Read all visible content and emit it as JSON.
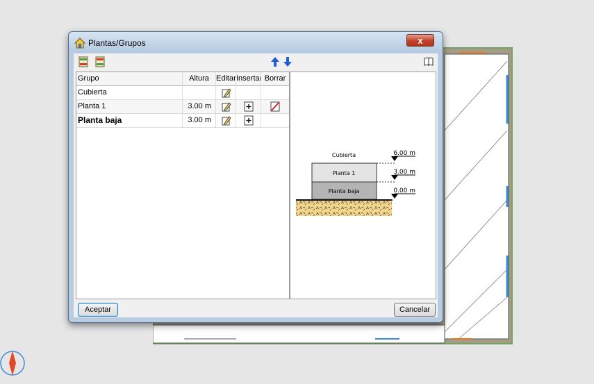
{
  "dialog": {
    "title": "Plantas/Grupos",
    "close_label": "x",
    "accept_label": "Aceptar",
    "cancel_label": "Cancelar",
    "toolbar_icons": [
      "insert-group-above-icon",
      "insert-group-below-icon",
      "move-up-arrow-icon",
      "move-down-arrow-icon",
      "help-book-icon"
    ]
  },
  "table": {
    "headers": {
      "grupo": "Grupo",
      "altura": "Altura",
      "editar": "Editar",
      "insertar": "Insertar",
      "borrar": "Borrar"
    },
    "rows": [
      {
        "grupo": "Cubierta",
        "altura": "",
        "editar": true,
        "insertar": false,
        "borrar": false
      },
      {
        "grupo": "Planta 1",
        "altura": "3.00 m",
        "editar": true,
        "insertar": true,
        "borrar": true
      },
      {
        "grupo": "Planta baja",
        "altura": "3.00 m",
        "editar": true,
        "insertar": true,
        "borrar": false
      }
    ]
  },
  "preview": {
    "floors": [
      "Cubierta",
      "Planta 1",
      "Planta baja"
    ],
    "levels": [
      "6.00 m",
      "3.00 m",
      "0.00 m"
    ],
    "colors": {
      "floor_label": "#1a3cc8",
      "planta1_fill": "#e4e4e4",
      "plantabaja_fill": "#b4b4b4",
      "ground": "#f2d58c"
    }
  }
}
